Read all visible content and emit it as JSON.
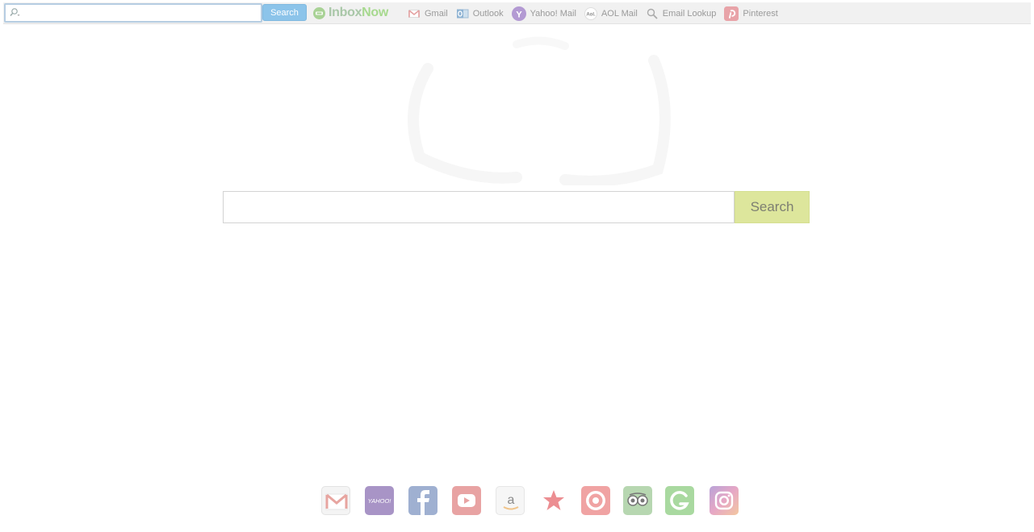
{
  "toolbar": {
    "search_value": "",
    "search_button": "Search",
    "logo": {
      "inbox": "Inbox",
      "now": "Now"
    },
    "links": [
      {
        "label": "Gmail",
        "icon": "gmail-icon"
      },
      {
        "label": "Outlook",
        "icon": "outlook-icon"
      },
      {
        "label": "Yahoo! Mail",
        "icon": "yahoo-icon"
      },
      {
        "label": "AOL Mail",
        "icon": "aol-icon"
      },
      {
        "label": "Email Lookup",
        "icon": "magnifier-icon"
      },
      {
        "label": "Pinterest",
        "icon": "pinterest-icon"
      }
    ]
  },
  "main": {
    "search_value": "",
    "search_button": "Search"
  },
  "tiles": [
    {
      "name": "gmail-tile",
      "icon": "gmail-icon",
      "color": "#f4f4f4"
    },
    {
      "name": "yahoo-tile",
      "icon": "yahoo-icon",
      "label": "YAHOO!",
      "color": "#a894c6"
    },
    {
      "name": "facebook-tile",
      "icon": "facebook-icon",
      "color": "#9fb0d1"
    },
    {
      "name": "youtube-tile",
      "icon": "youtube-icon",
      "color": "#e8a3a3"
    },
    {
      "name": "amazon-tile",
      "icon": "amazon-icon",
      "label": "a",
      "color": "#f6f6f6"
    },
    {
      "name": "macys-tile",
      "icon": "star-icon",
      "color": "#ffffff"
    },
    {
      "name": "target-tile",
      "icon": "target-icon",
      "color": "#f0a3a3"
    },
    {
      "name": "tripadvisor-tile",
      "icon": "owl-icon",
      "color": "#b7d7b1"
    },
    {
      "name": "grammarly-tile",
      "icon": "grammarly-icon",
      "color": "#a9d9a0"
    },
    {
      "name": "instagram-tile",
      "icon": "instagram-icon",
      "color": "#d8a8cc"
    }
  ]
}
